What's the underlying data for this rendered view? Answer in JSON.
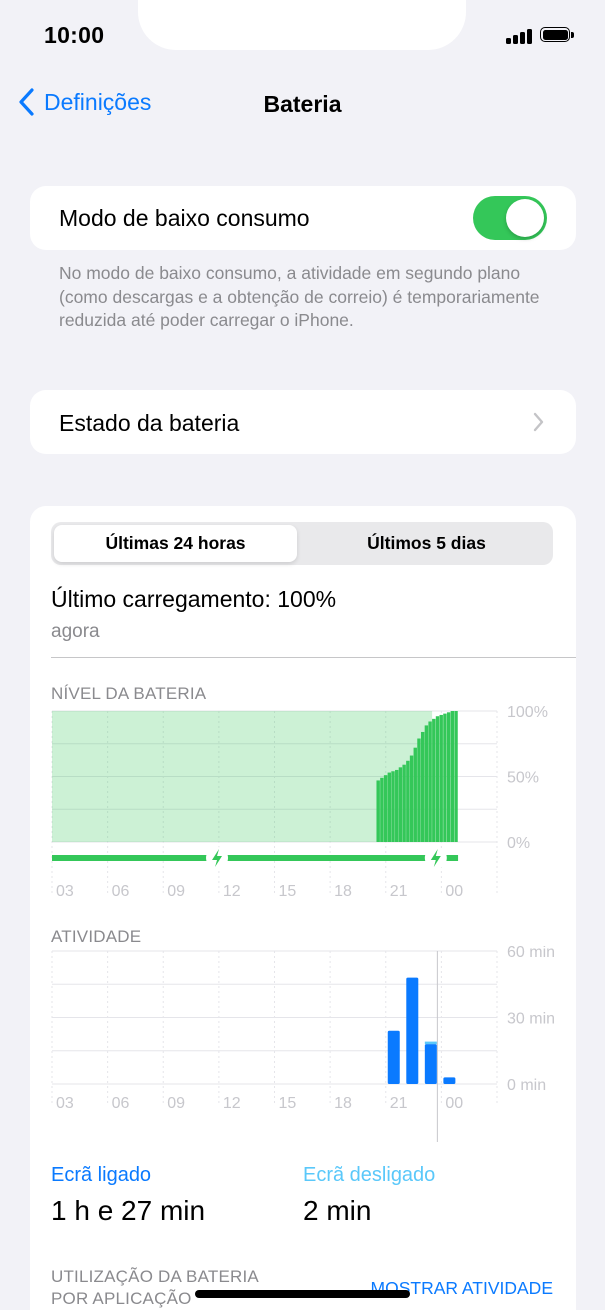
{
  "status_bar": {
    "time": "10:00"
  },
  "nav": {
    "back_label": "Definições",
    "title": "Bateria"
  },
  "low_power": {
    "label": "Modo de baixo consumo",
    "enabled": true,
    "footnote": "No modo de baixo consumo, a atividade em segundo plano (como descargas e a obtenção de correio) é temporariamente reduzida até poder carregar o iPhone."
  },
  "battery_health": {
    "label": "Estado da bateria"
  },
  "usage": {
    "segments": [
      "Últimas 24 horas",
      "Últimos 5 dias"
    ],
    "selected_segment": 0,
    "last_charge": "Último carregamento: 100%",
    "last_charge_time": "agora",
    "screen_on_label": "Ecrã ligado",
    "screen_on_value": "1 h e 27 min",
    "screen_off_label": "Ecrã desligado",
    "screen_off_value": "2 min",
    "app_usage_label": "UTILIZAÇÃO DA BATERIA POR APLICAÇÃO",
    "show_activity": "MOSTRAR ATIVIDADE"
  },
  "colors": {
    "accent": "#0a7aff",
    "green": "#34c759",
    "battery_green": "#4cd964",
    "activity_blue": "#0a7aff"
  },
  "chart_data": [
    {
      "type": "bar",
      "title": "NÍVEL DA BATERIA",
      "unit": "%",
      "ylim": [
        0,
        100
      ],
      "y_ticks": [
        "100%",
        "50%",
        "0%"
      ],
      "x_ticks": [
        "03",
        "06",
        "09",
        "12",
        "15",
        "18",
        "21",
        "00"
      ],
      "hours_span": 24,
      "charging_band_start_hour": 0,
      "charging_band_end_hour": 20.5,
      "charging_band_level": 100,
      "charging_markers_hours": [
        8.9,
        20.7
      ],
      "bars": [
        {
          "hour": 17.5,
          "value": 47
        },
        {
          "hour": 17.7,
          "value": 49
        },
        {
          "hour": 17.9,
          "value": 51
        },
        {
          "hour": 18.1,
          "value": 53
        },
        {
          "hour": 18.3,
          "value": 54
        },
        {
          "hour": 18.5,
          "value": 55
        },
        {
          "hour": 18.7,
          "value": 57
        },
        {
          "hour": 18.9,
          "value": 59
        },
        {
          "hour": 19.1,
          "value": 62
        },
        {
          "hour": 19.3,
          "value": 66
        },
        {
          "hour": 19.5,
          "value": 72
        },
        {
          "hour": 19.7,
          "value": 79
        },
        {
          "hour": 19.9,
          "value": 84
        },
        {
          "hour": 20.1,
          "value": 89
        },
        {
          "hour": 20.3,
          "value": 92
        },
        {
          "hour": 20.5,
          "value": 94
        },
        {
          "hour": 20.7,
          "value": 96
        },
        {
          "hour": 20.9,
          "value": 97
        },
        {
          "hour": 21.1,
          "value": 98
        },
        {
          "hour": 21.3,
          "value": 99
        },
        {
          "hour": 21.5,
          "value": 100
        },
        {
          "hour": 21.7,
          "value": 100
        }
      ]
    },
    {
      "type": "bar",
      "title": "ATIVIDADE",
      "unit": "min",
      "ylim": [
        0,
        60
      ],
      "y_ticks": [
        "60 min",
        "30 min",
        "0 min"
      ],
      "x_ticks": [
        "03",
        "06",
        "09",
        "12",
        "15",
        "18",
        "21",
        "00"
      ],
      "hours_span": 24,
      "series": [
        {
          "name": "Ecrã ligado",
          "bars": [
            {
              "hour": 18,
              "value": 24
            },
            {
              "hour": 19,
              "value": 48
            },
            {
              "hour": 20,
              "value": 18
            },
            {
              "hour": 21,
              "value": 3
            }
          ]
        },
        {
          "name": "Ecrã desligado",
          "bars": [
            {
              "hour": 20,
              "value": 1
            }
          ]
        }
      ]
    }
  ]
}
